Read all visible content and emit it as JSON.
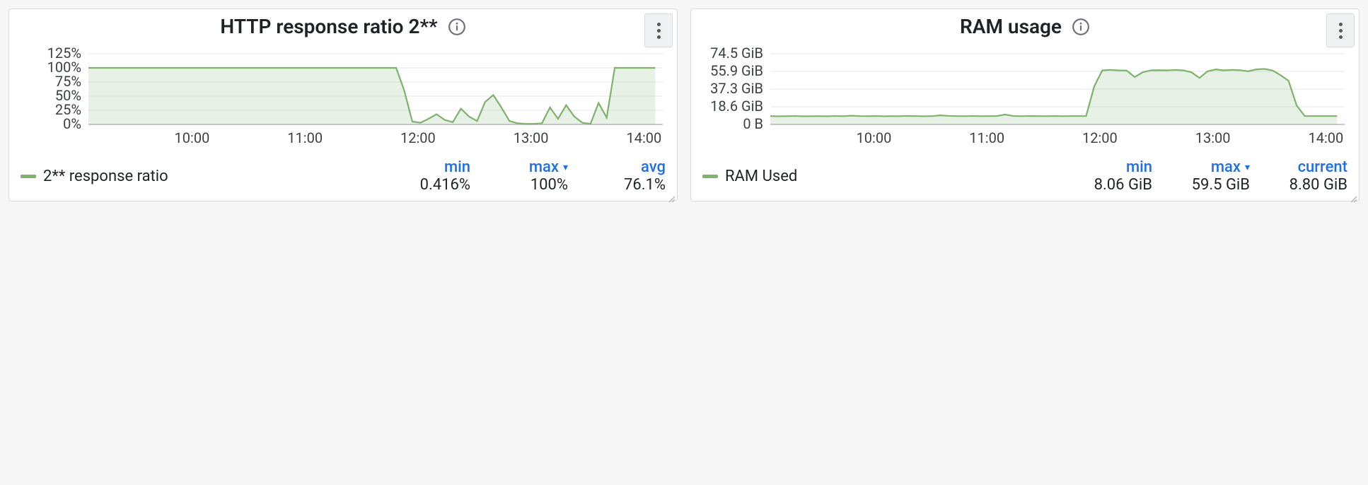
{
  "panels": [
    {
      "title": "HTTP response ratio 2**",
      "legend_label": "2** response ratio",
      "stats": [
        {
          "hdr": "min",
          "val": "0.416%",
          "chev": false
        },
        {
          "hdr": "max",
          "val": "100%",
          "chev": true
        },
        {
          "hdr": "avg",
          "val": "76.1%",
          "chev": false
        }
      ]
    },
    {
      "title": "RAM usage",
      "legend_label": "RAM Used",
      "stats": [
        {
          "hdr": "min",
          "val": "8.06 GiB",
          "chev": false
        },
        {
          "hdr": "max",
          "val": "59.5 GiB",
          "chev": true
        },
        {
          "hdr": "current",
          "val": "8.80 GiB",
          "chev": false
        }
      ]
    }
  ],
  "chart_data": [
    {
      "type": "area",
      "title": "HTTP response ratio 2**",
      "xlabel": "",
      "ylabel": "",
      "x_ticks": [
        "10:00",
        "11:00",
        "12:00",
        "13:00",
        "14:00"
      ],
      "y_ticks": [
        "0%",
        "25%",
        "50%",
        "75%",
        "100%",
        "125%"
      ],
      "ylim": [
        0,
        125
      ],
      "x_min_hhmm": "09:05",
      "x_max_hhmm": "14:10",
      "series": [
        {
          "name": "2** response ratio",
          "color": "#7eb26d",
          "values_percent": [
            100,
            100,
            100,
            100,
            100,
            100,
            100,
            100,
            100,
            100,
            100,
            100,
            100,
            100,
            100,
            100,
            100,
            100,
            100,
            100,
            100,
            100,
            100,
            100,
            100,
            100,
            100,
            100,
            100,
            100,
            100,
            100,
            100,
            100,
            100,
            100,
            100,
            100,
            100,
            60,
            5,
            3,
            10,
            18,
            8,
            4,
            28,
            14,
            6,
            40,
            52,
            30,
            6,
            2,
            1,
            1,
            2,
            30,
            10,
            34,
            14,
            3,
            1,
            38,
            12,
            100,
            100,
            100,
            100,
            100,
            100
          ],
          "values_x_hhmm_start": "09:05",
          "values_step_min": 4.3
        }
      ]
    },
    {
      "type": "area",
      "title": "RAM usage",
      "xlabel": "",
      "ylabel": "",
      "x_ticks": [
        "10:00",
        "11:00",
        "12:00",
        "13:00",
        "14:00"
      ],
      "y_ticks": [
        "0 B",
        "18.6 GiB",
        "37.3 GiB",
        "55.9 GiB",
        "74.5 GiB"
      ],
      "ylim": [
        0,
        74.5
      ],
      "x_min_hhmm": "09:05",
      "x_max_hhmm": "14:10",
      "series": [
        {
          "name": "RAM Used",
          "color": "#7eb26d",
          "unit": "GiB",
          "values": [
            8.8,
            8.6,
            8.7,
            8.9,
            8.6,
            8.7,
            8.8,
            8.6,
            8.9,
            8.7,
            9.2,
            8.8,
            8.7,
            8.9,
            8.6,
            8.8,
            8.7,
            9.0,
            8.8,
            8.6,
            8.8,
            9.6,
            9.0,
            8.8,
            8.7,
            8.9,
            8.7,
            8.8,
            8.9,
            10.4,
            8.9,
            8.7,
            8.9,
            8.8,
            8.7,
            8.9,
            8.7,
            8.8,
            8.8,
            8.9,
            40,
            57,
            57.5,
            57,
            56.8,
            50,
            55,
            57,
            57.2,
            57,
            57.5,
            57,
            55,
            49,
            56,
            58,
            57,
            57.5,
            57.2,
            56,
            58,
            58.5,
            57,
            52,
            46,
            20,
            8.8,
            8.8,
            8.8,
            8.8,
            8.8
          ],
          "values_x_hhmm_start": "09:05",
          "values_step_min": 4.3
        }
      ]
    }
  ]
}
